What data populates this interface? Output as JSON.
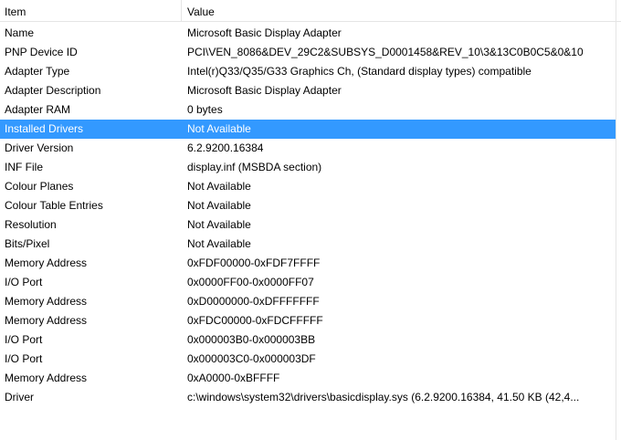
{
  "columns": {
    "item": "Item",
    "value": "Value"
  },
  "rows": [
    {
      "item": "Name",
      "value": "Microsoft Basic Display Adapter"
    },
    {
      "item": "PNP Device ID",
      "value": "PCI\\VEN_8086&DEV_29C2&SUBSYS_D0001458&REV_10\\3&13C0B0C5&0&10"
    },
    {
      "item": "Adapter Type",
      "value": "Intel(r)Q33/Q35/G33 Graphics Ch, (Standard display types) compatible"
    },
    {
      "item": "Adapter Description",
      "value": "Microsoft Basic Display Adapter"
    },
    {
      "item": "Adapter RAM",
      "value": "0 bytes"
    },
    {
      "item": "Installed Drivers",
      "value": "Not Available",
      "selected": true
    },
    {
      "item": "Driver Version",
      "value": "6.2.9200.16384"
    },
    {
      "item": "INF File",
      "value": "display.inf (MSBDA section)"
    },
    {
      "item": "Colour Planes",
      "value": "Not Available"
    },
    {
      "item": "Colour Table Entries",
      "value": "Not Available"
    },
    {
      "item": "Resolution",
      "value": "Not Available"
    },
    {
      "item": "Bits/Pixel",
      "value": "Not Available"
    },
    {
      "item": "Memory Address",
      "value": "0xFDF00000-0xFDF7FFFF"
    },
    {
      "item": "I/O Port",
      "value": "0x0000FF00-0x0000FF07"
    },
    {
      "item": "Memory Address",
      "value": "0xD0000000-0xDFFFFFFF"
    },
    {
      "item": "Memory Address",
      "value": "0xFDC00000-0xFDCFFFFF"
    },
    {
      "item": "I/O Port",
      "value": "0x000003B0-0x000003BB"
    },
    {
      "item": "I/O Port",
      "value": "0x000003C0-0x000003DF"
    },
    {
      "item": "Memory Address",
      "value": "0xA0000-0xBFFFF"
    },
    {
      "item": "Driver",
      "value": "c:\\windows\\system32\\drivers\\basicdisplay.sys (6.2.9200.16384, 41.50 KB (42,4..."
    }
  ]
}
